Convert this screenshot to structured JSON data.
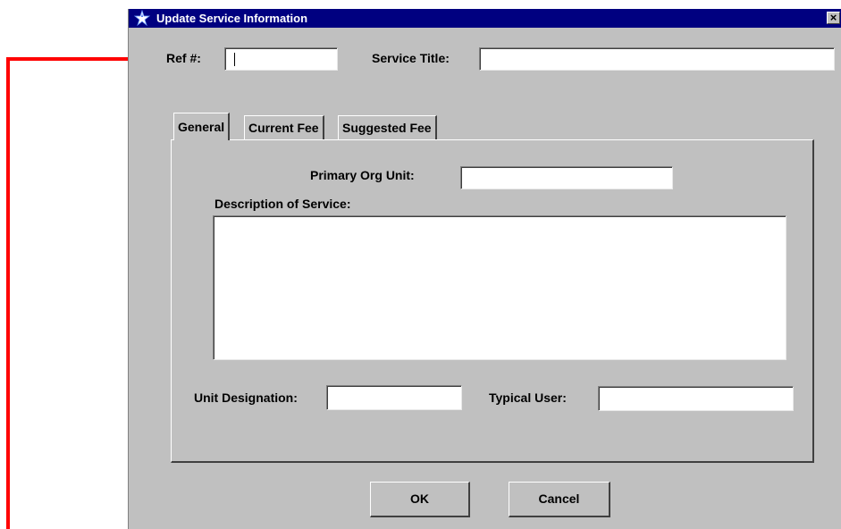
{
  "window": {
    "title": "Update Service Information",
    "close_glyph": "×"
  },
  "header": {
    "ref_label": "Ref #:",
    "ref_value": "",
    "service_title_label": "Service Title:",
    "service_title_value": ""
  },
  "tabs": [
    {
      "label": "General",
      "active": true
    },
    {
      "label": "Current Fee",
      "active": false
    },
    {
      "label": "Suggested Fee",
      "active": false
    }
  ],
  "general": {
    "primary_org_unit_label": "Primary Org Unit:",
    "primary_org_unit_value": "",
    "description_label": "Description of Service:",
    "description_value": "",
    "unit_designation_label": "Unit Designation:",
    "unit_designation_value": "",
    "typical_user_label": "Typical User:",
    "typical_user_value": ""
  },
  "buttons": {
    "ok_label": "OK",
    "cancel_label": "Cancel"
  },
  "colors": {
    "titlebar": "#000080",
    "dialog_bg": "#c0c0c0",
    "annotation_arrow": "#ff0000"
  },
  "icons": {
    "title_icon": "app-star-icon",
    "annotation": "red-arrow-icon"
  }
}
